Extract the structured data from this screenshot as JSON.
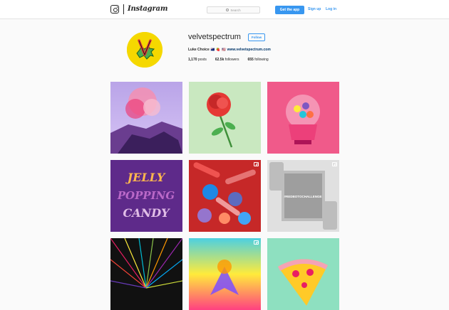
{
  "header": {
    "brand": "Instagram",
    "search_placeholder": "Search",
    "get_app": "Get the app",
    "sign_up": "Sign up",
    "log_in": "Log in"
  },
  "profile": {
    "username": "velvetspectrum",
    "follow_label": "Follow",
    "full_name": "Luke Choice",
    "bio_flags": [
      "🇳🇿",
      "🍓",
      "🇺🇸"
    ],
    "website": "www.velvetspectrum.com",
    "stats": {
      "posts_count": "1,170",
      "posts_label": "posts",
      "followers_count": "62.5k",
      "followers_label": "followers",
      "following_count": "655",
      "following_label": "following"
    }
  },
  "posts": [
    {
      "name": "post-1-pink-tree"
    },
    {
      "name": "post-2-rose"
    },
    {
      "name": "post-3-gumball-machine"
    },
    {
      "name": "post-4-jelly-popping-candy",
      "text": "JELLY POPPING CANDY"
    },
    {
      "name": "post-5-candy-pile",
      "is_video": true
    },
    {
      "name": "post-6-challenge",
      "text": "#REDBOTOCHALLENGE",
      "is_video": true
    },
    {
      "name": "post-7-starburst"
    },
    {
      "name": "post-8-neon-gradient",
      "is_video": true
    },
    {
      "name": "post-9-pizza"
    }
  ]
}
